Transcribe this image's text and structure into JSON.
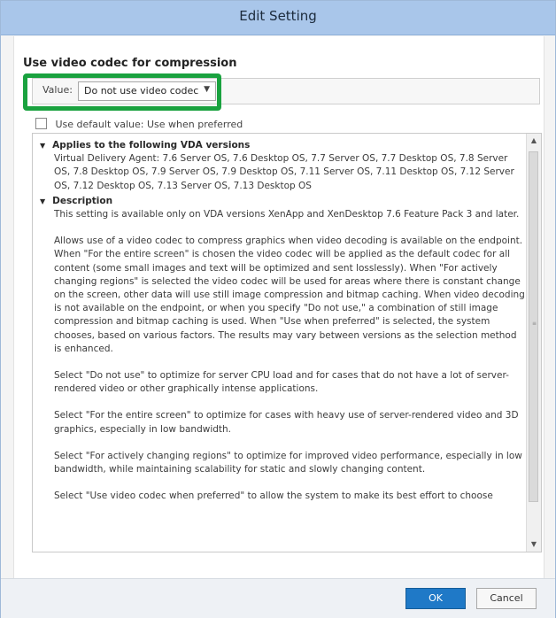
{
  "window": {
    "title": "Edit Setting"
  },
  "setting": {
    "heading": "Use video codec for compression",
    "value_label": "Value:",
    "selected_value": "Do not use video codec",
    "default_checkbox_label": "Use default value: Use when preferred",
    "default_checked": false
  },
  "details": {
    "applies_title": "Applies to the following VDA versions",
    "applies_text": "Virtual Delivery Agent: 7.6 Server OS, 7.6 Desktop OS, 7.7 Server OS, 7.7 Desktop OS, 7.8 Server OS, 7.8 Desktop OS, 7.9 Server OS, 7.9 Desktop OS, 7.11 Server OS, 7.11 Desktop OS, 7.12 Server OS, 7.12 Desktop OS, 7.13 Server OS, 7.13 Desktop OS",
    "description_title": "Description",
    "paragraphs": [
      "This setting is available only on VDA versions XenApp and XenDesktop 7.6 Feature Pack 3 and later.",
      "Allows use of a video codec to compress graphics when video decoding is available on the endpoint. When \"For the entire screen\" is chosen the video codec will be applied as the default codec for all content (some small images and text will be optimized and sent losslessly). When \"For actively changing regions\" is selected the video codec will be used for areas where there is constant change on the screen, other data will use still image compression and bitmap caching. When video decoding is not available on the endpoint, or when you specify \"Do not use,\" a combination of still image compression and bitmap caching is used. When \"Use when preferred\" is selected, the system chooses, based on various factors. The results may vary between versions as the selection method is enhanced.",
      "Select \"Do not use\" to optimize for server CPU load and for cases that do not have a lot of server-rendered video or other graphically intense applications.",
      "Select \"For the entire screen\" to optimize for cases with heavy use of server-rendered video and 3D graphics, especially in low bandwidth.",
      "Select \"For actively changing regions\" to optimize for improved video performance, especially in low bandwidth, while maintaining scalability for static and slowly changing content.",
      "Select \"Use video codec when preferred\" to allow the system to make its best effort to choose"
    ]
  },
  "buttons": {
    "ok": "OK",
    "cancel": "Cancel"
  },
  "colors": {
    "titlebar": "#a9c6ea",
    "highlight": "#1aa23f",
    "ok_button": "#1f79c7"
  }
}
